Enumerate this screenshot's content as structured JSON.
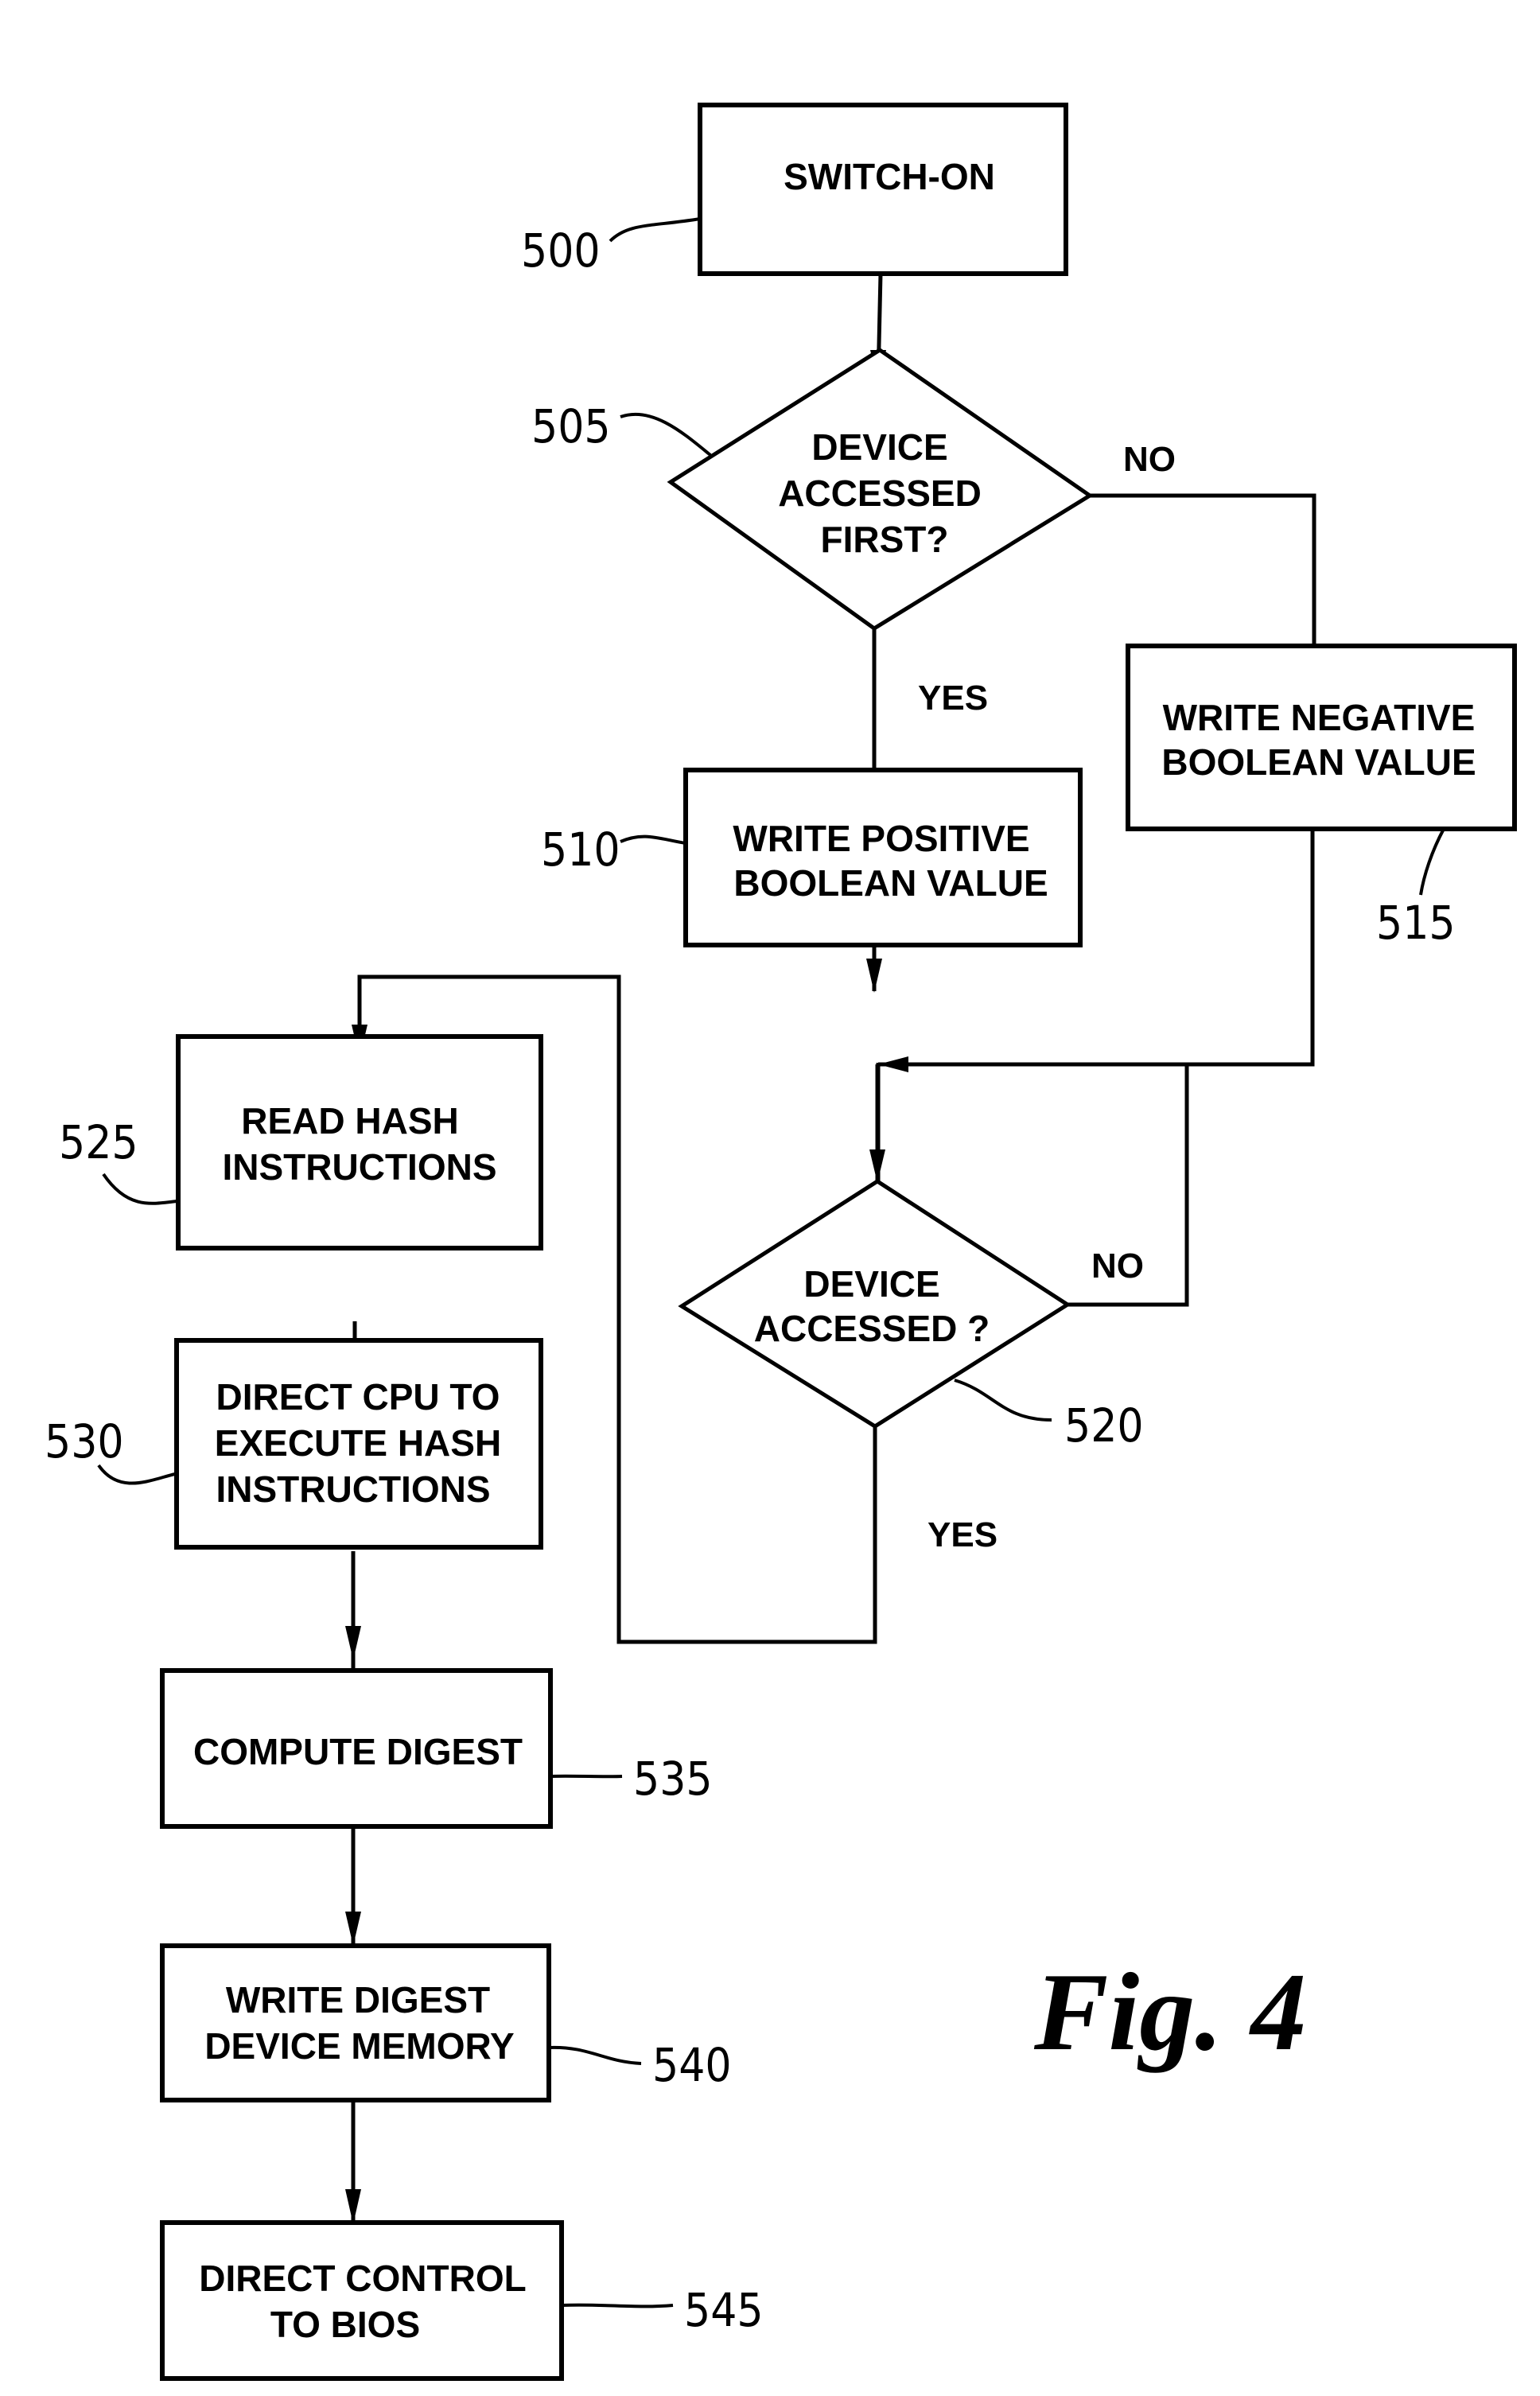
{
  "figure": {
    "caption": "Fig. 4",
    "nodes": [
      {
        "id": "500",
        "type": "process",
        "lines": [
          "SWITCH-ON"
        ]
      },
      {
        "id": "505",
        "type": "decision",
        "lines": [
          "DEVICE",
          "ACCESSED",
          "FIRST?"
        ]
      },
      {
        "id": "510",
        "type": "process",
        "lines": [
          "WRITE POSITIVE",
          "BOOLEAN VALUE"
        ]
      },
      {
        "id": "515",
        "type": "process",
        "lines": [
          "WRITE NEGATIVE",
          "BOOLEAN VALUE"
        ]
      },
      {
        "id": "520",
        "type": "decision",
        "lines": [
          "DEVICE",
          "ACCESSED ?"
        ]
      },
      {
        "id": "525",
        "type": "process",
        "lines": [
          "READ HASH",
          "INSTRUCTIONS"
        ]
      },
      {
        "id": "530",
        "type": "process",
        "lines": [
          "DIRECT CPU TO",
          "EXECUTE HASH",
          "INSTRUCTIONS"
        ]
      },
      {
        "id": "535",
        "type": "process",
        "lines": [
          "COMPUTE DIGEST"
        ]
      },
      {
        "id": "540",
        "type": "process",
        "lines": [
          "WRITE DIGEST",
          "DEVICE MEMORY"
        ]
      },
      {
        "id": "545",
        "type": "process",
        "lines": [
          "DIRECT CONTROL",
          "TO BIOS"
        ]
      }
    ],
    "edges": [
      {
        "from": "500",
        "to": "505",
        "label": ""
      },
      {
        "from": "505",
        "to": "510",
        "label": "YES"
      },
      {
        "from": "505",
        "to": "515",
        "label": "NO"
      },
      {
        "from": "510",
        "to": "520",
        "label": ""
      },
      {
        "from": "515",
        "to": "520",
        "label": ""
      },
      {
        "from": "520",
        "to": "520",
        "label": "NO"
      },
      {
        "from": "520",
        "to": "525",
        "label": "YES"
      },
      {
        "from": "525",
        "to": "530",
        "label": ""
      },
      {
        "from": "530",
        "to": "535",
        "label": ""
      },
      {
        "from": "535",
        "to": "540",
        "label": ""
      },
      {
        "from": "540",
        "to": "545",
        "label": ""
      }
    ],
    "branch_labels": {
      "d505_no": "NO",
      "d505_yes": "YES",
      "d520_no": "NO",
      "d520_yes": "YES"
    },
    "ref_labels": {
      "r500": "500",
      "r505": "505",
      "r510": "510",
      "r515": "515",
      "r520": "520",
      "r525": "525",
      "r530": "530",
      "r535": "535",
      "r540": "540",
      "r545": "545"
    }
  }
}
